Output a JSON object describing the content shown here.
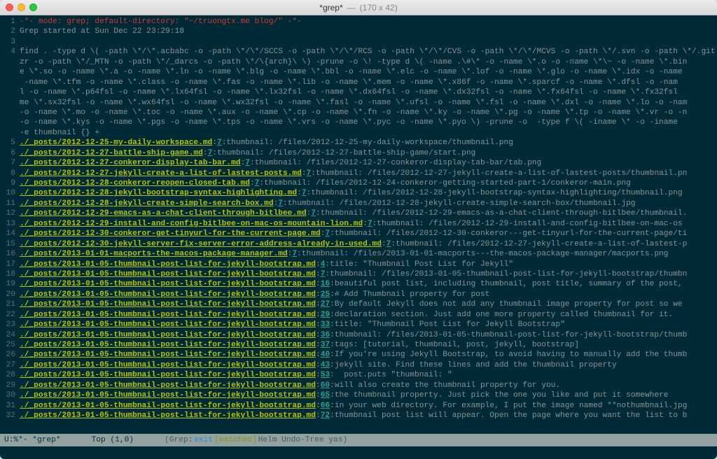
{
  "window": {
    "title_main": "*grep*",
    "title_sep": "—",
    "title_dims": "(170 x 42)"
  },
  "header": {
    "line1_num": "1",
    "line1_text": "-*- mode: grep; default-directory: \"~/truongtx.me blog/\" -*-",
    "line2_num": "2",
    "line2_text": "Grep started at Sun Dec 22 23:29:18",
    "line3_num": "3",
    "line4_num": "4"
  },
  "find_cmd": [
    "find . -type d \\( -path \\*/\\*.acbabc -o -path \\*/\\*/SCCS -o -path \\*/\\*/RCS -o -path \\*/\\*/CVS -o -path \\*/\\*/MCVS -o -path \\*/.svn -o -path \\*/.git -o -p",
    "zr -o -path \\*/_MTN -o -path \\*/_darcs -o -path \\*/\\{arch}\\ \\) -prune -o \\! -type d \\( -name .\\#\\* -o -name \\*.o -o -name \\*\\~ -o -name \\*.bin",
    "e \\*.so -o -name \\*.a -o -name \\*.ln -o -name \\*.blg -o -name \\*.bbl -o -name \\*.elc -o -name \\*.lof -o -name \\*.glo -o -name \\*.idx -o -name",
    " -name \\*.tfm -o -name \\*.class -o -name \\*.fas -o -name \\*.lib -o -name \\*.mem -o -name \\*.x86f -o -name \\*.sparcf -o -name \\*.dfsl -o -nam",
    "l -o -name \\*.p64fsl -o -name \\*.lx64fsl -o -name \\*.lx32fsl -o -name \\*.dx64fsl -o -name \\*.dx32fsl -o -name \\*.fx64fsl -o -name \\*.fx32fsl",
    "me \\*.sx32fsl -o -name \\*.wx64fsl -o -name \\*.wx32fsl -o -name \\*.fasl -o -name \\*.ufsl -o -name \\*.fsl -o -name \\*.dxl -o -name \\*.lo -o -nam",
    "-o -name \\*.mo -o -name \\*.toc -o -name \\*.aux -o -name \\*.cp -o -name \\*.fn -o -name \\*.ky -o -name \\*.pg -o -name \\*.tp -o -name \\*.vr -o -n",
    "-o -name \\*.kys -o -name \\*.pgs -o -name \\*.tps -o -name \\*.vrs -o -name \\*.pyc -o -name \\*.pyo \\) -prune -o  -type f \\( -iname \\* -o -iname",
    "-e thumbnail {} +"
  ],
  "hits": [
    {
      "n": "5",
      "file": "./_posts/2012-12-25-my-daily-workspace.md",
      "ln": "7",
      "rest": "thumbnail: /files/2012-12-25-my-daily-workspace/thumbnail.png"
    },
    {
      "n": "6",
      "file": "./_posts/2012-12-27-battle-ship-game.md",
      "ln": "7",
      "rest": "thumbnail: /files/2012-12-27-battle-ship-game/start.png"
    },
    {
      "n": "7",
      "file": "./_posts/2012-12-27-conkeror-display-tab-bar.md",
      "ln": "7",
      "rest": "thumbnail: /files/2012-12-27-conkeror-display-tab-bar/tab.png"
    },
    {
      "n": "8",
      "file": "./_posts/2012-12-27-jekyll-create-a-list-of-lastest-posts.md",
      "ln": "7",
      "rest": "thumbnail: /files/2012-12-27-jekyll-create-a-list-of-lastest-posts/thumbnail.pn"
    },
    {
      "n": "9",
      "file": "./_posts/2012-12-28-conkeror-reopen-closed-tab.md",
      "ln": "7",
      "rest": "thumbnail: /files/2012-12-24-conkeror-getting-started-part-1/conkeror-main.png"
    },
    {
      "n": "10",
      "file": "./_posts/2012-12-28-jekyll-bootstrap-syntax-highlighting.md",
      "ln": "7",
      "rest": "thumbnail: /files/2012-12-28-jekyll-bootstrap-syntax-highlighting/thumbnail.png"
    },
    {
      "n": "11",
      "file": "./_posts/2012-12-28-jekyll-create-simple-search-box.md",
      "ln": "7",
      "rest": "thumbnail: /files/2012-12-28-jekyll-create-simple-search-box/thumbnail.jpg"
    },
    {
      "n": "12",
      "file": "./_posts/2012-12-29-emacs-as-a-chat-client-through-bitlbee.md",
      "ln": "7",
      "rest": "thumbnail: /files/2012-12-29-emacs-as-a-chat-client-through-bitlbee/thumbnail."
    },
    {
      "n": "13",
      "file": "./_posts/2012-12-29-install-and-config-bitlbee-on-mac-os-mountain-lion.md",
      "ln": "7",
      "rest": "thumbnail: /files/2012-12-29-install-and-config-bitlbee-on-mac-os"
    },
    {
      "n": "14",
      "file": "./_posts/2012-12-30-conkeror-get-tinyurl-for-the-current-page.md",
      "ln": "7",
      "rest": "thumbnail: /files/2012-12-30-conkeror---get-tinyurl-for-the-current-page/ti"
    },
    {
      "n": "15",
      "file": "./_posts/2012-12-30-jekyll-server-fix-server-error-address-already-in-used.md",
      "ln": "7",
      "rest": "thumbnail: /files/2012-12-27-jekyll-create-a-list-of-lastest-p"
    },
    {
      "n": "16",
      "file": "./_posts/2013-01-01-macports-the-macos-package-manager.md",
      "ln": "7",
      "rest": "thumbnail: /files/2013-01-01-macports---the-macos-package-manager/macports.png"
    },
    {
      "n": "17",
      "file": "./_posts/2013-01-05-thumbnail-post-list-for-jekyll-bootstrap.md",
      "ln": "4",
      "rest": "title: \"Thumbnail Post List for Jekyll\""
    },
    {
      "n": "18",
      "file": "./_posts/2013-01-05-thumbnail-post-list-for-jekyll-bootstrap.md",
      "ln": "7",
      "rest": "thumbnail: /files/2013-01-05-thumbnail-post-list-for-jekyll-bootstrap/thumbn"
    },
    {
      "n": "19",
      "file": "./_posts/2013-01-05-thumbnail-post-list-for-jekyll-bootstrap.md",
      "ln": "16",
      "rest": "beautiful post list, including thumbnail, post title, summary of the post,"
    },
    {
      "n": "20",
      "file": "./_posts/2013-01-05-thumbnail-post-list-for-jekyll-bootstrap.md",
      "ln": "25",
      "rest": "# Add Thumbnail property for post"
    },
    {
      "n": "21",
      "file": "./_posts/2013-01-05-thumbnail-post-list-for-jekyll-bootstrap.md",
      "ln": "27",
      "rest": "By default Jekyll does not add any thumbnail image property for post so we"
    },
    {
      "n": "22",
      "file": "./_posts/2013-01-05-thumbnail-post-list-for-jekyll-bootstrap.md",
      "ln": "29",
      "rest": "declaration section. Just add one more property called thumbnail for it."
    },
    {
      "n": "23",
      "file": "./_posts/2013-01-05-thumbnail-post-list-for-jekyll-bootstrap.md",
      "ln": "33",
      "rest": "title: \"Thumbnail Post List for Jekyll Bootstrap\""
    },
    {
      "n": "24",
      "file": "./_posts/2013-01-05-thumbnail-post-list-for-jekyll-bootstrap.md",
      "ln": "36",
      "rest": "thumbnail: /files/2013-01-05-thumbnail-post-list-for-jekyll-bootstrap/thumb"
    },
    {
      "n": "25",
      "file": "./_posts/2013-01-05-thumbnail-post-list-for-jekyll-bootstrap.md",
      "ln": "37",
      "rest": "tags: [tutorial, thumbnail, post, jekyll, bootstrap]"
    },
    {
      "n": "26",
      "file": "./_posts/2013-01-05-thumbnail-post-list-for-jekyll-bootstrap.md",
      "ln": "40",
      "rest": "If you're using Jekyll Bootstrap, to avoid having to manually add the thumb"
    },
    {
      "n": "27",
      "file": "./_posts/2013-01-05-thumbnail-post-list-for-jekyll-bootstrap.md",
      "ln": "43",
      "rest": "jekyll site. Find these lines and add the thumbnail property"
    },
    {
      "n": "28",
      "file": "./_posts/2013-01-05-thumbnail-post-list-for-jekyll-bootstrap.md",
      "ln": "53",
      "rest": "  post.puts \"thumbnail: \""
    },
    {
      "n": "29",
      "file": "./_posts/2013-01-05-thumbnail-post-list-for-jekyll-bootstrap.md",
      "ln": "60",
      "rest": "will also create the thumbnail property for you."
    },
    {
      "n": "30",
      "file": "./_posts/2013-01-05-thumbnail-post-list-for-jekyll-bootstrap.md",
      "ln": "65",
      "rest": "the thumbnail property. Just pick the one you like and put it somewhere"
    },
    {
      "n": "31",
      "file": "./_posts/2013-01-05-thumbnail-post-list-for-jekyll-bootstrap.md",
      "ln": "66",
      "rest": "in your web directory. For example, I put the image named **nothumbnail.jpg"
    },
    {
      "n": "32",
      "file": "./_posts/2013-01-05-thumbnail-post-list-for-jekyll-bootstrap.md",
      "ln": "72",
      "rest": "thumbnail post list will appear. Open the page where you want the list to b"
    }
  ],
  "modeline": {
    "left": "U:%*-  *grep*",
    "pos": "Top (1,0)",
    "group_open": "(Grep:",
    "exit": "exit",
    "matched": " [matched]",
    "group_close": " Helm Undo-Tree yas)"
  }
}
